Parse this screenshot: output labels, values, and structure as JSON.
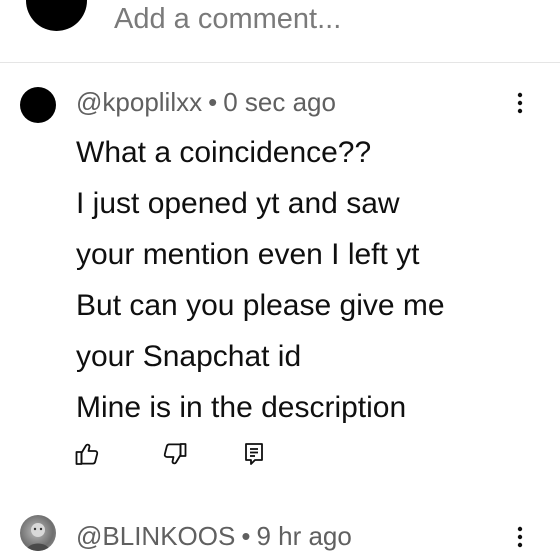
{
  "add_comment": {
    "placeholder": "Add a comment..."
  },
  "comments": [
    {
      "author": "@kpoplilxx",
      "separator": "•",
      "time": "0 sec ago",
      "lines": [
        "What a coincidence??",
        "I just opened yt and saw",
        "your mention even I left yt",
        "But can you please give me",
        "your Snapchat id",
        "Mine is in the description"
      ],
      "actions": [
        "like-icon",
        "dislike-icon",
        "reply-icon"
      ]
    },
    {
      "author": "@BLINKOOS",
      "separator": "•",
      "time": "9 hr ago"
    }
  ],
  "icons": {
    "more": "more-vert-icon"
  }
}
